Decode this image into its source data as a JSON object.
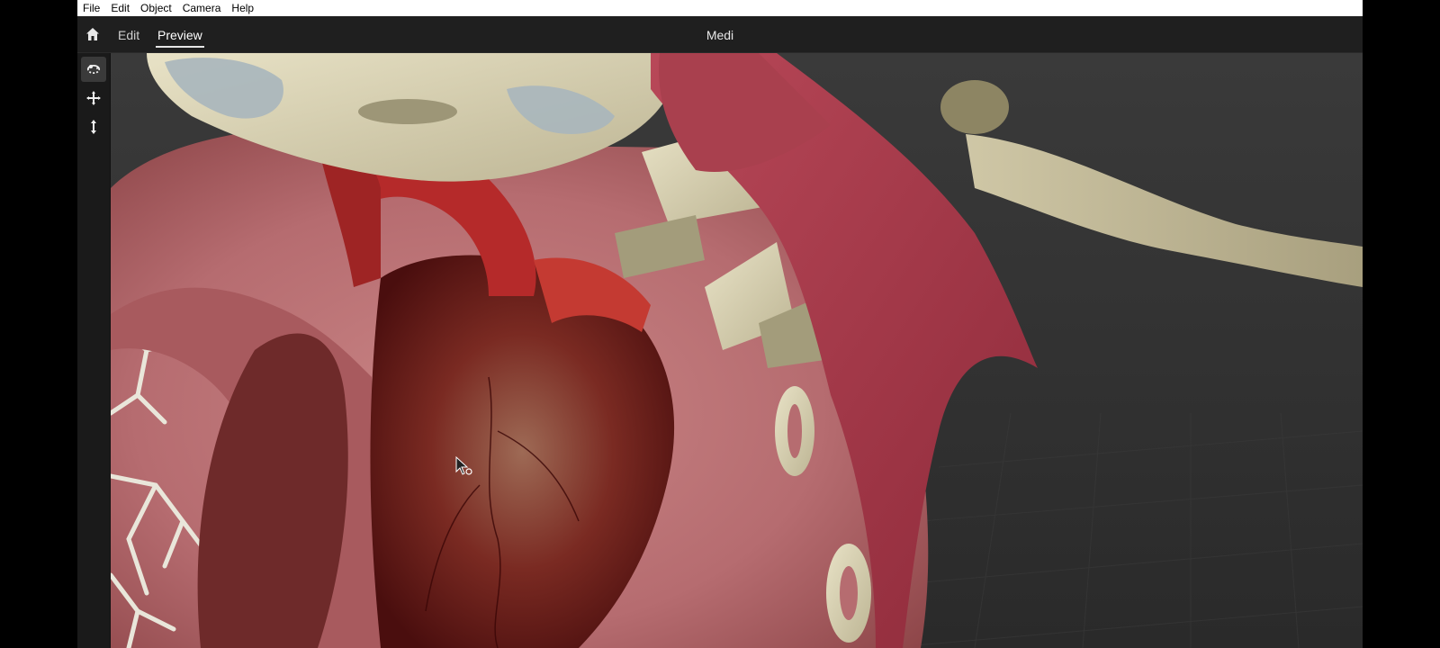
{
  "menubar": {
    "items": [
      "File",
      "Edit",
      "Object",
      "Camera",
      "Help"
    ]
  },
  "header": {
    "home_icon": "home-icon",
    "tabs": [
      {
        "label": "Edit"
      },
      {
        "label": "Preview",
        "active": true
      }
    ],
    "document_title": "Medi"
  },
  "toolbar": {
    "tools": [
      {
        "icon": "orbit-icon",
        "active": true
      },
      {
        "icon": "pan-icon",
        "active": false
      },
      {
        "icon": "zoom-icon",
        "active": false
      }
    ]
  },
  "viewport": {
    "content": "3D anatomy model",
    "background_color": "#333333",
    "tissue_colors": {
      "pericardium": "#b86a6e",
      "heart": "#7a2020",
      "bone": "#d9d3b5",
      "muscle": "#a83c4a"
    }
  }
}
